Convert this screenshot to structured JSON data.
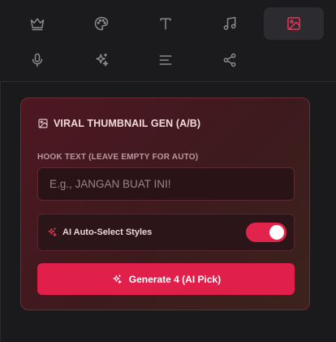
{
  "toolbar": {
    "tools": [
      {
        "icon": "crown-icon",
        "active": false
      },
      {
        "icon": "palette-icon",
        "active": false
      },
      {
        "icon": "text-icon",
        "active": false
      },
      {
        "icon": "music-icon",
        "active": false
      },
      {
        "icon": "image-icon",
        "active": true
      },
      {
        "icon": "microphone-icon",
        "active": false
      },
      {
        "icon": "sparkles-icon",
        "active": false
      },
      {
        "icon": "align-left-icon",
        "active": false
      },
      {
        "icon": "share-icon",
        "active": false
      }
    ]
  },
  "panel": {
    "title": "VIRAL THUMBNAIL GEN (A/B)",
    "hook_label": "HOOK TEXT (LEAVE EMPTY FOR AUTO)",
    "hook_placeholder": "E.g., JANGAN BUAT INI!",
    "hook_value": "",
    "auto_select_label": "AI Auto-Select Styles",
    "auto_select_enabled": true,
    "generate_label": "Generate 4 (AI Pick)"
  },
  "colors": {
    "accent": "#e11f4b",
    "active_icon": "#e8365a",
    "background": "#1a1a1c"
  }
}
